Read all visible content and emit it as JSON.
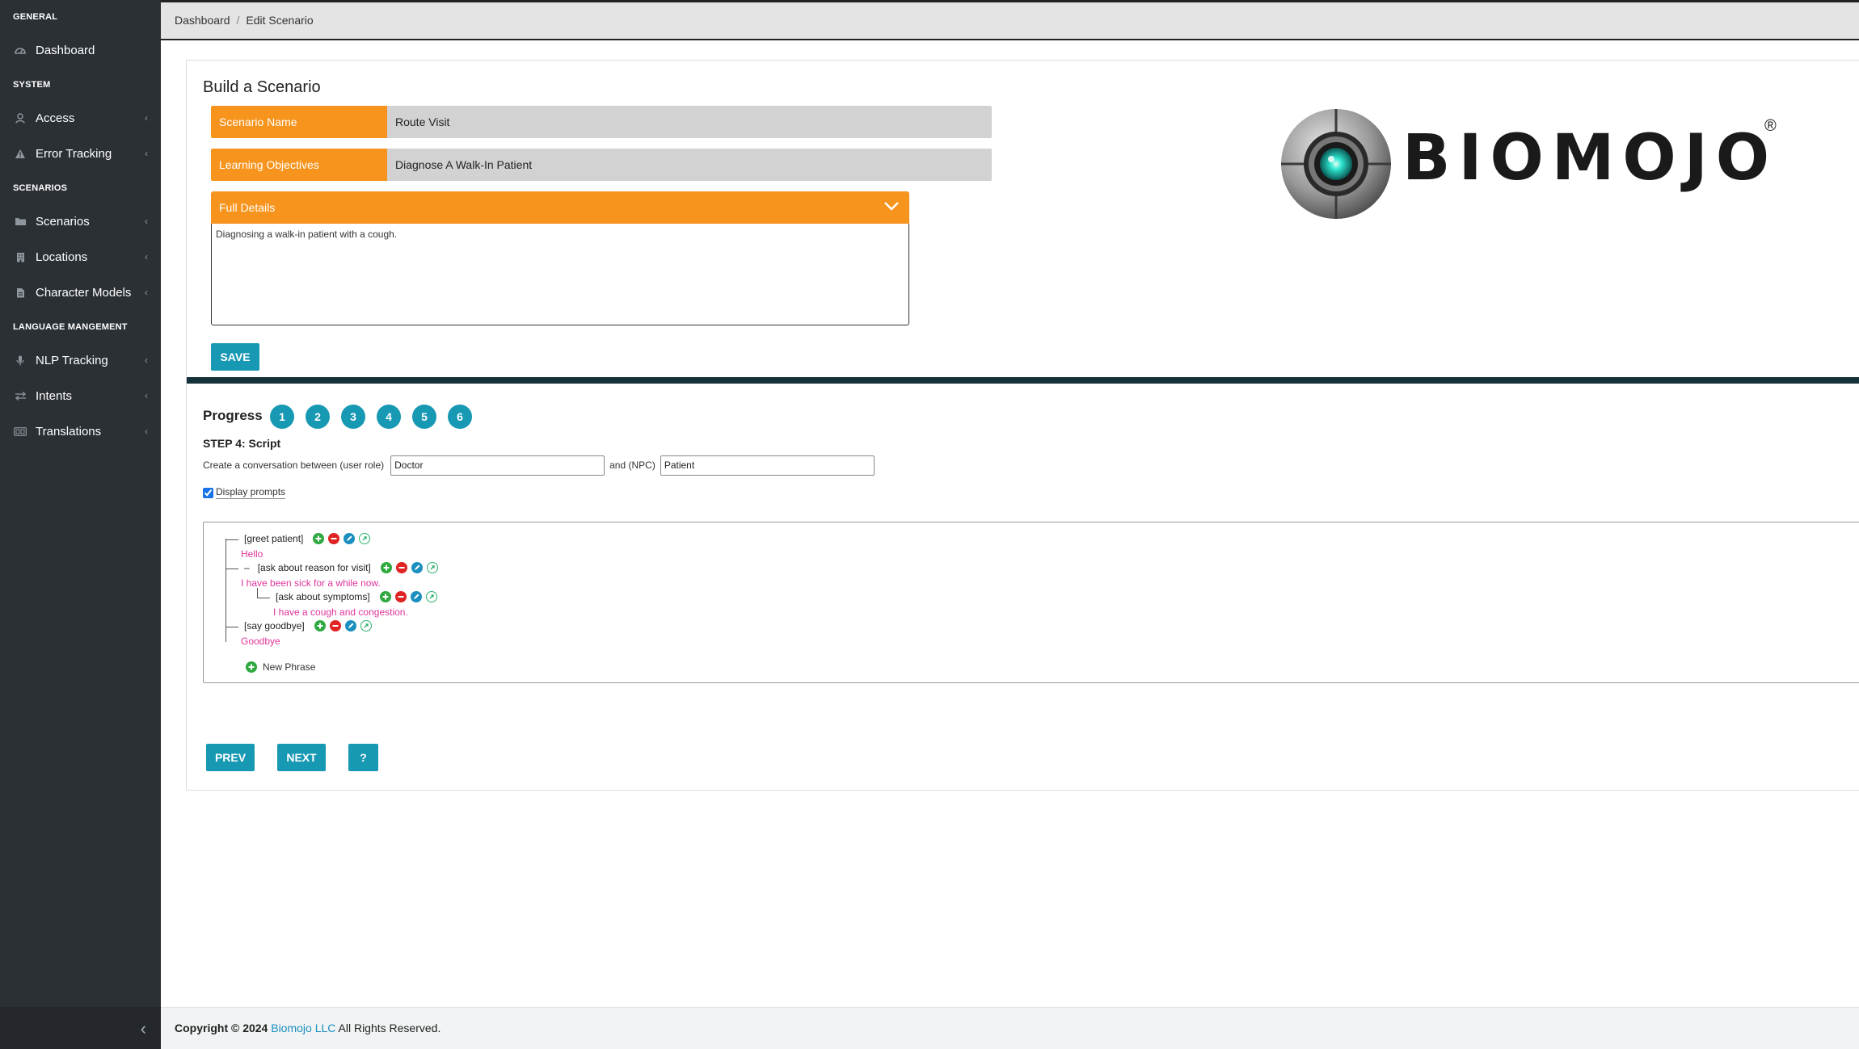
{
  "sidebar": {
    "sections": [
      {
        "title": "GENERAL",
        "items": [
          {
            "label": "Dashboard",
            "icon": "dashboard-icon",
            "chevron": false
          }
        ]
      },
      {
        "title": "SYSTEM",
        "items": [
          {
            "label": "Access",
            "icon": "user-icon",
            "chevron": true
          },
          {
            "label": "Error Tracking",
            "icon": "warning-icon",
            "chevron": true
          }
        ]
      },
      {
        "title": "SCENARIOS",
        "items": [
          {
            "label": "Scenarios",
            "icon": "folder-icon",
            "chevron": true
          },
          {
            "label": "Locations",
            "icon": "building-icon",
            "chevron": true
          },
          {
            "label": "Character Models",
            "icon": "file-icon",
            "chevron": true
          }
        ]
      },
      {
        "title": "LANGUAGE MANGEMENT",
        "items": [
          {
            "label": "NLP Tracking",
            "icon": "microphone-icon",
            "chevron": true
          },
          {
            "label": "Intents",
            "icon": "arrows-icon",
            "chevron": true
          },
          {
            "label": "Translations",
            "icon": "translate-icon",
            "chevron": true
          }
        ]
      }
    ],
    "chevron_glyph": "‹",
    "collapse_glyph": "‹"
  },
  "breadcrumb": {
    "home": "Dashboard",
    "separator": "/",
    "current": "Edit Scenario"
  },
  "card": {
    "title": "Build a Scenario",
    "scenario_name": {
      "label": "Scenario Name",
      "value": "Route Visit"
    },
    "learning_objectives": {
      "label": "Learning Objectives",
      "value": "Diagnose A Walk-In Patient"
    },
    "full_details": {
      "label": "Full Details",
      "value": "Diagnosing a walk-in patient with a cough."
    },
    "save_label": "SAVE"
  },
  "logo": {
    "text": "BIOMOJO",
    "mark": "®"
  },
  "progress": {
    "label": "Progress",
    "steps": [
      "1",
      "2",
      "3",
      "4",
      "5",
      "6"
    ]
  },
  "step": {
    "title": "STEP 4: Script",
    "conv_prefix": "Create a conversation between (user role)",
    "user_role": "Doctor",
    "npc_label": "and (NPC)",
    "npc_role": "Patient",
    "display_prompts_label": "Display prompts",
    "display_prompts_checked": true
  },
  "script": {
    "nodes": [
      {
        "prompt": "[greet patient]",
        "response": "Hello"
      },
      {
        "prompt": "[ask about reason for visit]",
        "response": "I have been sick for a while now."
      },
      {
        "prompt": "[ask about symptoms]",
        "response": "I have a cough and congestion."
      },
      {
        "prompt": "[say goodbye]",
        "response": "Goodbye"
      }
    ],
    "collapse_glyph": "–",
    "new_phrase_label": "New Phrase"
  },
  "nav": {
    "prev_label": "PREV",
    "next_label": "NEXT",
    "help_label": "?"
  },
  "footer": {
    "copyright": "Copyright © 2024",
    "company": "Biomojo LLC",
    "rights": "All Rights Reserved."
  },
  "colors": {
    "accent": "#1798b3",
    "orange": "#f7941d",
    "sidebar": "#2b3035",
    "response": "#e0359b",
    "add": "#2ea83f",
    "remove": "#e02424",
    "edit": "#1b8fbf",
    "link": "#2fb36b"
  }
}
